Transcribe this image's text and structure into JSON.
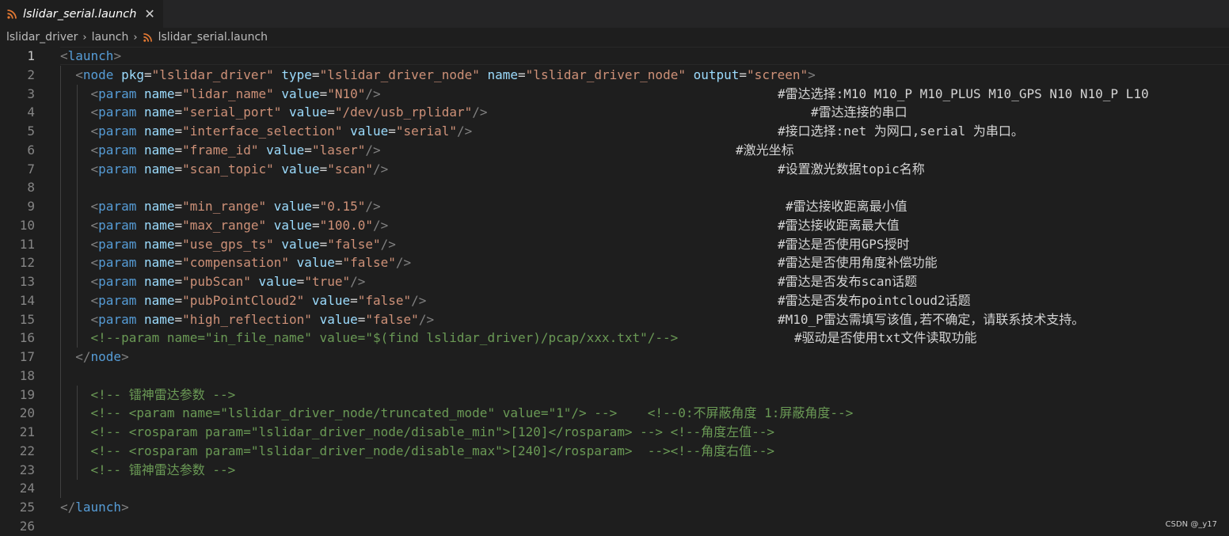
{
  "tab": {
    "title": "lslidar_serial.launch",
    "close_glyph": "✕",
    "icon": "rss-icon",
    "icon_color": "#e37933"
  },
  "breadcrumb": {
    "items": [
      "lslidar_driver",
      "launch",
      "lslidar_serial.launch"
    ],
    "separator": "›"
  },
  "colors": {
    "tag": "#569cd6",
    "attr": "#9cdcfe",
    "string": "#ce9178",
    "comment": "#6a9955",
    "text": "#d4d4d4",
    "background": "#1e1e1e"
  },
  "active_line": 1,
  "lines": [
    {
      "n": "1",
      "seg": [
        [
          "br",
          "<"
        ],
        [
          "tag",
          "launch"
        ],
        [
          "br",
          ">"
        ]
      ],
      "note": ""
    },
    {
      "n": "2",
      "seg": [
        [
          "txt",
          "  "
        ],
        [
          "br",
          "<"
        ],
        [
          "tag",
          "node"
        ],
        [
          "txt",
          " "
        ],
        [
          "attr",
          "pkg"
        ],
        [
          "txt",
          "="
        ],
        [
          "str",
          "\"lslidar_driver\""
        ],
        [
          "txt",
          " "
        ],
        [
          "attr",
          "type"
        ],
        [
          "txt",
          "="
        ],
        [
          "str",
          "\"lslidar_driver_node\""
        ],
        [
          "txt",
          " "
        ],
        [
          "attr",
          "name"
        ],
        [
          "txt",
          "="
        ],
        [
          "str",
          "\"lslidar_driver_node\""
        ],
        [
          "txt",
          " "
        ],
        [
          "attr",
          "output"
        ],
        [
          "txt",
          "="
        ],
        [
          "str",
          "\"screen\""
        ],
        [
          "br",
          ">"
        ]
      ],
      "note": ""
    },
    {
      "n": "3",
      "seg": [
        [
          "txt",
          "    "
        ],
        [
          "br",
          "<"
        ],
        [
          "tag",
          "param"
        ],
        [
          "txt",
          " "
        ],
        [
          "attr",
          "name"
        ],
        [
          "txt",
          "="
        ],
        [
          "str",
          "\"lidar_name\""
        ],
        [
          "txt",
          " "
        ],
        [
          "attr",
          "value"
        ],
        [
          "txt",
          "="
        ],
        [
          "str",
          "\"N10\""
        ],
        [
          "br",
          "/>"
        ]
      ],
      "note": "#雷达选择:M10 M10_P M10_PLUS M10_GPS N10 N10_P L10"
    },
    {
      "n": "4",
      "seg": [
        [
          "txt",
          "    "
        ],
        [
          "br",
          "<"
        ],
        [
          "tag",
          "param"
        ],
        [
          "txt",
          " "
        ],
        [
          "attr",
          "name"
        ],
        [
          "txt",
          "="
        ],
        [
          "str",
          "\"serial_port\""
        ],
        [
          "txt",
          " "
        ],
        [
          "attr",
          "value"
        ],
        [
          "txt",
          "="
        ],
        [
          "str",
          "\"/dev/usb_rplidar\""
        ],
        [
          "br",
          "/>"
        ]
      ],
      "note": "#雷达连接的串口"
    },
    {
      "n": "5",
      "seg": [
        [
          "txt",
          "    "
        ],
        [
          "br",
          "<"
        ],
        [
          "tag",
          "param"
        ],
        [
          "txt",
          " "
        ],
        [
          "attr",
          "name"
        ],
        [
          "txt",
          "="
        ],
        [
          "str",
          "\"interface_selection\""
        ],
        [
          "txt",
          " "
        ],
        [
          "attr",
          "value"
        ],
        [
          "txt",
          "="
        ],
        [
          "str",
          "\"serial\""
        ],
        [
          "br",
          "/>"
        ]
      ],
      "note": "#接口选择:net 为网口,serial 为串口。"
    },
    {
      "n": "6",
      "seg": [
        [
          "txt",
          "    "
        ],
        [
          "br",
          "<"
        ],
        [
          "tag",
          "param"
        ],
        [
          "txt",
          " "
        ],
        [
          "attr",
          "name"
        ],
        [
          "txt",
          "="
        ],
        [
          "str",
          "\"frame_id\""
        ],
        [
          "txt",
          " "
        ],
        [
          "attr",
          "value"
        ],
        [
          "txt",
          "="
        ],
        [
          "str",
          "\"laser\""
        ],
        [
          "br",
          "/>"
        ]
      ],
      "note": "#激光坐标"
    },
    {
      "n": "7",
      "seg": [
        [
          "txt",
          "    "
        ],
        [
          "br",
          "<"
        ],
        [
          "tag",
          "param"
        ],
        [
          "txt",
          " "
        ],
        [
          "attr",
          "name"
        ],
        [
          "txt",
          "="
        ],
        [
          "str",
          "\"scan_topic\""
        ],
        [
          "txt",
          " "
        ],
        [
          "attr",
          "value"
        ],
        [
          "txt",
          "="
        ],
        [
          "str",
          "\"scan\""
        ],
        [
          "br",
          "/>"
        ]
      ],
      "note": "#设置激光数据topic名称"
    },
    {
      "n": "8",
      "seg": [],
      "note": ""
    },
    {
      "n": "9",
      "seg": [
        [
          "txt",
          "    "
        ],
        [
          "br",
          "<"
        ],
        [
          "tag",
          "param"
        ],
        [
          "txt",
          " "
        ],
        [
          "attr",
          "name"
        ],
        [
          "txt",
          "="
        ],
        [
          "str",
          "\"min_range\""
        ],
        [
          "txt",
          " "
        ],
        [
          "attr",
          "value"
        ],
        [
          "txt",
          "="
        ],
        [
          "str",
          "\"0.15\""
        ],
        [
          "br",
          "/>"
        ]
      ],
      "note": "#雷达接收距离最小值"
    },
    {
      "n": "10",
      "seg": [
        [
          "txt",
          "    "
        ],
        [
          "br",
          "<"
        ],
        [
          "tag",
          "param"
        ],
        [
          "txt",
          " "
        ],
        [
          "attr",
          "name"
        ],
        [
          "txt",
          "="
        ],
        [
          "str",
          "\"max_range\""
        ],
        [
          "txt",
          " "
        ],
        [
          "attr",
          "value"
        ],
        [
          "txt",
          "="
        ],
        [
          "str",
          "\"100.0\""
        ],
        [
          "br",
          "/>"
        ]
      ],
      "note": "#雷达接收距离最大值"
    },
    {
      "n": "11",
      "seg": [
        [
          "txt",
          "    "
        ],
        [
          "br",
          "<"
        ],
        [
          "tag",
          "param"
        ],
        [
          "txt",
          " "
        ],
        [
          "attr",
          "name"
        ],
        [
          "txt",
          "="
        ],
        [
          "str",
          "\"use_gps_ts\""
        ],
        [
          "txt",
          " "
        ],
        [
          "attr",
          "value"
        ],
        [
          "txt",
          "="
        ],
        [
          "str",
          "\"false\""
        ],
        [
          "br",
          "/>"
        ]
      ],
      "note": "#雷达是否使用GPS授时"
    },
    {
      "n": "12",
      "seg": [
        [
          "txt",
          "    "
        ],
        [
          "br",
          "<"
        ],
        [
          "tag",
          "param"
        ],
        [
          "txt",
          " "
        ],
        [
          "attr",
          "name"
        ],
        [
          "txt",
          "="
        ],
        [
          "str",
          "\"compensation\""
        ],
        [
          "txt",
          " "
        ],
        [
          "attr",
          "value"
        ],
        [
          "txt",
          "="
        ],
        [
          "str",
          "\"false\""
        ],
        [
          "br",
          "/>"
        ]
      ],
      "note": "#雷达是否使用角度补偿功能"
    },
    {
      "n": "13",
      "seg": [
        [
          "txt",
          "    "
        ],
        [
          "br",
          "<"
        ],
        [
          "tag",
          "param"
        ],
        [
          "txt",
          " "
        ],
        [
          "attr",
          "name"
        ],
        [
          "txt",
          "="
        ],
        [
          "str",
          "\"pubScan\""
        ],
        [
          "txt",
          " "
        ],
        [
          "attr",
          "value"
        ],
        [
          "txt",
          "="
        ],
        [
          "str",
          "\"true\""
        ],
        [
          "br",
          "/>"
        ]
      ],
      "note": "#雷达是否发布scan话题"
    },
    {
      "n": "14",
      "seg": [
        [
          "txt",
          "    "
        ],
        [
          "br",
          "<"
        ],
        [
          "tag",
          "param"
        ],
        [
          "txt",
          " "
        ],
        [
          "attr",
          "name"
        ],
        [
          "txt",
          "="
        ],
        [
          "str",
          "\"pubPointCloud2\""
        ],
        [
          "txt",
          " "
        ],
        [
          "attr",
          "value"
        ],
        [
          "txt",
          "="
        ],
        [
          "str",
          "\"false\""
        ],
        [
          "br",
          "/>"
        ]
      ],
      "note": "#雷达是否发布pointcloud2话题"
    },
    {
      "n": "15",
      "seg": [
        [
          "txt",
          "    "
        ],
        [
          "br",
          "<"
        ],
        [
          "tag",
          "param"
        ],
        [
          "txt",
          " "
        ],
        [
          "attr",
          "name"
        ],
        [
          "txt",
          "="
        ],
        [
          "str",
          "\"high_reflection\""
        ],
        [
          "txt",
          " "
        ],
        [
          "attr",
          "value"
        ],
        [
          "txt",
          "="
        ],
        [
          "str",
          "\"false\""
        ],
        [
          "br",
          "/>"
        ]
      ],
      "note": "#M10_P雷达需填写该值,若不确定，请联系技术支持。"
    },
    {
      "n": "16",
      "seg": [
        [
          "txt",
          "    "
        ],
        [
          "cmt",
          "<!--param name=\"in_file_name\" value=\"$(find lslidar_driver)/pcap/xxx.txt\"/-->"
        ]
      ],
      "note": "#驱动是否使用txt文件读取功能"
    },
    {
      "n": "17",
      "seg": [
        [
          "txt",
          "  "
        ],
        [
          "br",
          "</"
        ],
        [
          "tag",
          "node"
        ],
        [
          "br",
          ">"
        ]
      ],
      "note": ""
    },
    {
      "n": "18",
      "seg": [],
      "note": ""
    },
    {
      "n": "19",
      "seg": [
        [
          "txt",
          "    "
        ],
        [
          "cmt",
          "<!-- 镭神雷达参数 -->"
        ]
      ],
      "note": ""
    },
    {
      "n": "20",
      "seg": [
        [
          "txt",
          "    "
        ],
        [
          "cmt",
          "<!-- <param name=\"lslidar_driver_node/truncated_mode\" value=\"1\"/> -->    <!--0:不屏蔽角度 1:屏蔽角度-->"
        ]
      ],
      "note": ""
    },
    {
      "n": "21",
      "seg": [
        [
          "txt",
          "    "
        ],
        [
          "cmt",
          "<!-- <rosparam param=\"lslidar_driver_node/disable_min\">[120]</rosparam> --> <!--角度左值-->"
        ]
      ],
      "note": ""
    },
    {
      "n": "22",
      "seg": [
        [
          "txt",
          "    "
        ],
        [
          "cmt",
          "<!-- <rosparam param=\"lslidar_driver_node/disable_max\">[240]</rosparam>  --><!--角度右值-->"
        ]
      ],
      "note": ""
    },
    {
      "n": "23",
      "seg": [
        [
          "txt",
          "    "
        ],
        [
          "cmt",
          "<!-- 镭神雷达参数 -->"
        ]
      ],
      "note": ""
    },
    {
      "n": "24",
      "seg": [],
      "note": ""
    },
    {
      "n": "25",
      "seg": [
        [
          "br",
          "</"
        ],
        [
          "tag",
          "launch"
        ],
        [
          "br",
          ">"
        ]
      ],
      "note": ""
    },
    {
      "n": "26",
      "seg": [],
      "note": ""
    }
  ],
  "watermark": "CSDN @_y17"
}
